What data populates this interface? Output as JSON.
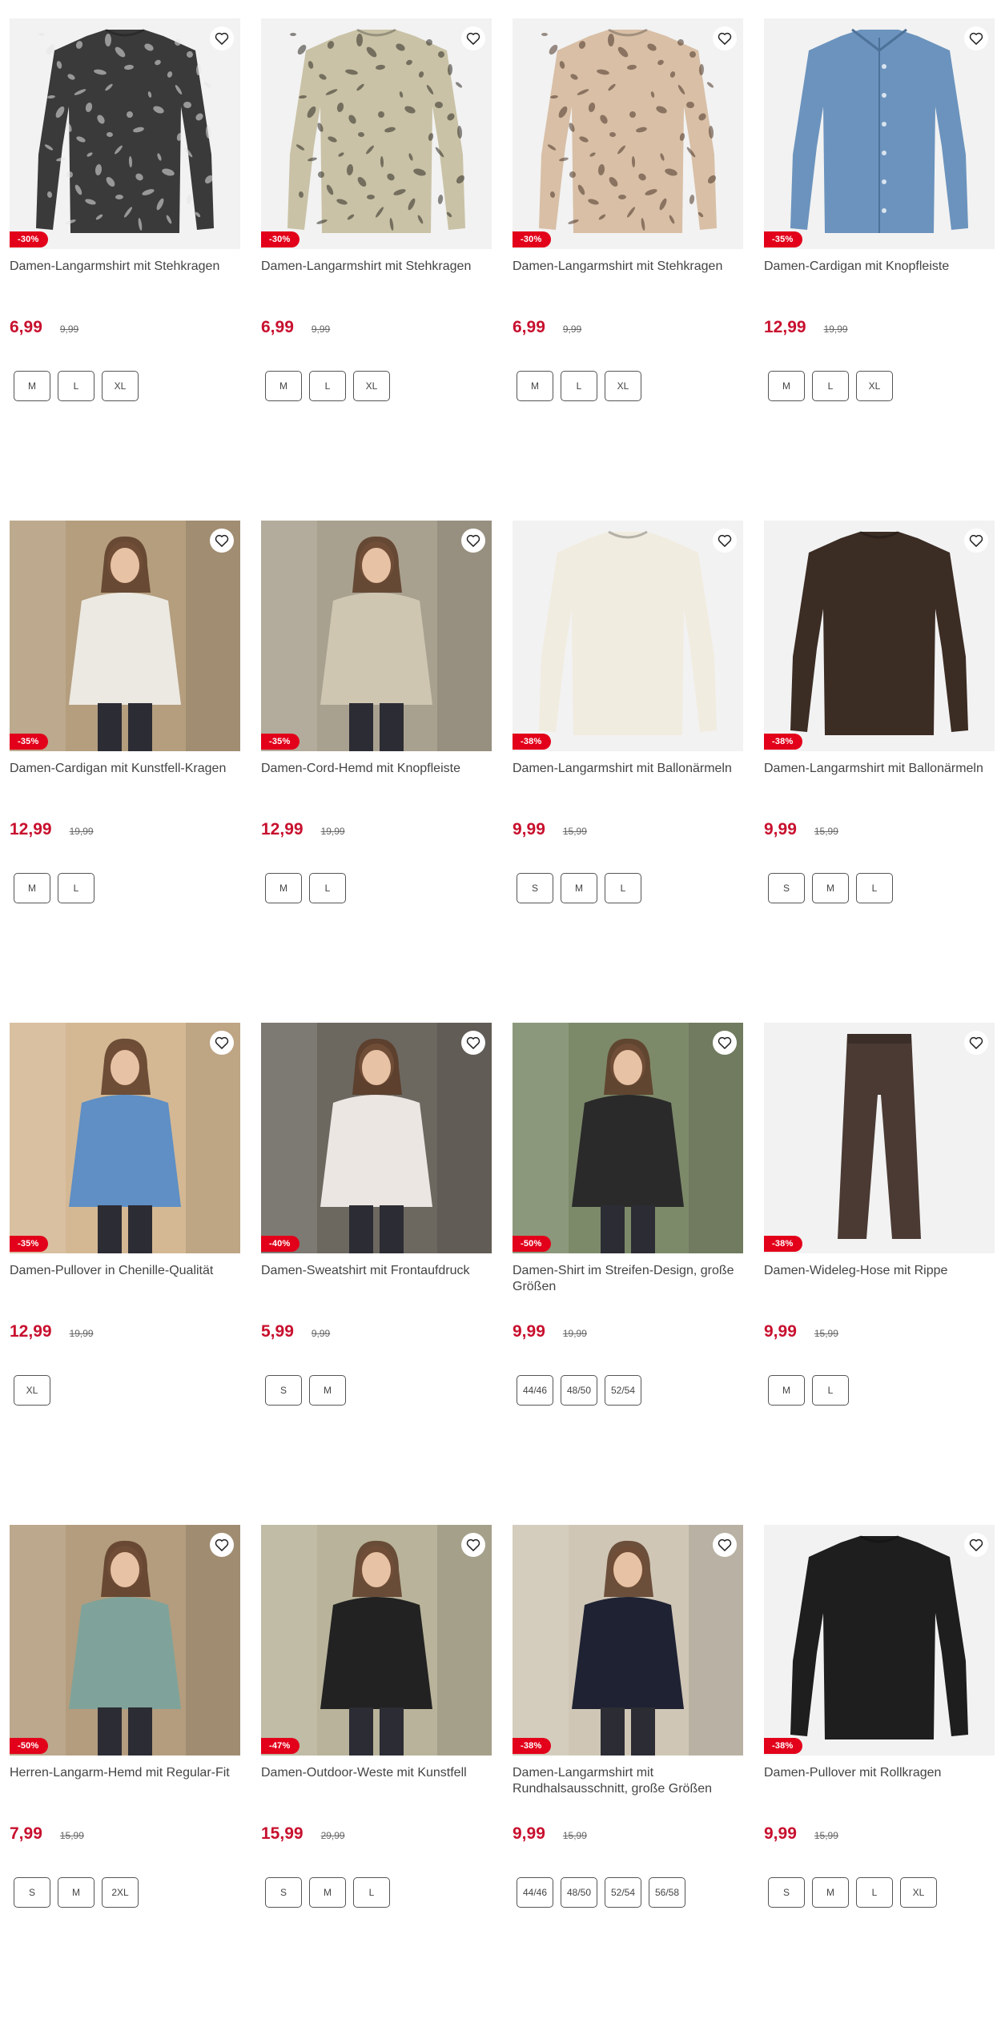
{
  "products": [
    {
      "title": "Damen-Langarmshirt mit Stehkragen",
      "price": "6,99",
      "old_price": "9,99",
      "discount": "-30%",
      "sizes": [
        "M",
        "L",
        "XL"
      ],
      "image": "garment",
      "color": "#3a3a3a",
      "pattern": "#e6e6e6",
      "garment": "shirt"
    },
    {
      "title": "Damen-Langarmshirt mit Stehkragen",
      "price": "6,99",
      "old_price": "9,99",
      "discount": "-30%",
      "sizes": [
        "M",
        "L",
        "XL"
      ],
      "image": "garment",
      "color": "#c9c2a6",
      "pattern": "#2e2a22",
      "garment": "shirt"
    },
    {
      "title": "Damen-Langarmshirt mit Stehkragen",
      "price": "6,99",
      "old_price": "9,99",
      "discount": "-30%",
      "sizes": [
        "M",
        "L",
        "XL"
      ],
      "image": "garment",
      "color": "#d8bfa6",
      "pattern": "#4a3426",
      "garment": "shirt"
    },
    {
      "title": "Damen-Cardigan mit Knopfleiste",
      "price": "12,99",
      "old_price": "19,99",
      "discount": "-35%",
      "sizes": [
        "M",
        "L",
        "XL"
      ],
      "image": "garment",
      "color": "#6b93bd",
      "pattern": "",
      "garment": "cardigan"
    },
    {
      "title": "Damen-Cardigan mit Kunstfell-Kragen",
      "price": "12,99",
      "old_price": "19,99",
      "discount": "-35%",
      "sizes": [
        "M",
        "L"
      ],
      "image": "photo",
      "color": "#ece9e2",
      "bg": "#b49e7e",
      "garment": "model"
    },
    {
      "title": "Damen-Cord-Hemd mit Knopfleiste",
      "price": "12,99",
      "old_price": "19,99",
      "discount": "-35%",
      "sizes": [
        "M",
        "L"
      ],
      "image": "photo",
      "color": "#cfc6b2",
      "bg": "#a9a18f",
      "garment": "model"
    },
    {
      "title": "Damen-Langarmshirt mit Ballonärmeln",
      "price": "9,99",
      "old_price": "15,99",
      "discount": "-38%",
      "sizes": [
        "S",
        "M",
        "L"
      ],
      "image": "garment",
      "color": "#f1ece0",
      "pattern": "",
      "garment": "sweater"
    },
    {
      "title": "Damen-Langarmshirt mit Ballonärmeln",
      "price": "9,99",
      "old_price": "15,99",
      "discount": "-38%",
      "sizes": [
        "S",
        "M",
        "L"
      ],
      "image": "garment",
      "color": "#3b2c24",
      "pattern": "",
      "garment": "sweater"
    },
    {
      "title": "Damen-Pullover in Chenille-Qualität",
      "price": "12,99",
      "old_price": "19,99",
      "discount": "-35%",
      "sizes": [
        "XL"
      ],
      "image": "photo",
      "color": "#5f8fc4",
      "bg": "#d4b894",
      "garment": "model"
    },
    {
      "title": "Damen-Sweatshirt mit Frontaufdruck",
      "price": "5,99",
      "old_price": "9,99",
      "discount": "-40%",
      "sizes": [
        "S",
        "M"
      ],
      "image": "photo",
      "color": "#ece6e2",
      "bg": "#6c6860",
      "garment": "model"
    },
    {
      "title": "Damen-Shirt im Streifen-Design, große Größen",
      "price": "9,99",
      "old_price": "19,99",
      "discount": "-50%",
      "sizes": [
        "44/46",
        "48/50",
        "52/54"
      ],
      "image": "photo",
      "color": "#2a2a2a",
      "bg": "#7d8a6a",
      "garment": "model"
    },
    {
      "title": "Damen-Wideleg-Hose mit Rippe",
      "price": "9,99",
      "old_price": "15,99",
      "discount": "-38%",
      "sizes": [
        "M",
        "L"
      ],
      "image": "garment",
      "color": "#4a3a33",
      "pattern": "",
      "garment": "pants"
    },
    {
      "title": "Herren-Langarm-Hemd mit Regular-Fit",
      "price": "7,99",
      "old_price": "15,99",
      "discount": "-50%",
      "sizes": [
        "S",
        "M",
        "2XL"
      ],
      "image": "photo",
      "color": "#7fa39a",
      "bg": "#b39d7e",
      "garment": "model"
    },
    {
      "title": "Damen-Outdoor-Weste mit Kunstfell",
      "price": "15,99",
      "old_price": "29,99",
      "discount": "-47%",
      "sizes": [
        "S",
        "M",
        "L"
      ],
      "image": "photo",
      "color": "#222222",
      "bg": "#b8b39a",
      "garment": "model"
    },
    {
      "title": "Damen-Langarmshirt mit Rundhalsausschnitt, große Größen",
      "price": "9,99",
      "old_price": "15,99",
      "discount": "-38%",
      "sizes": [
        "44/46",
        "48/50",
        "52/54",
        "56/58"
      ],
      "image": "photo",
      "color": "#1f2233",
      "bg": "#cfc6b6",
      "garment": "model"
    },
    {
      "title": "Damen-Pullover mit Rollkragen",
      "price": "9,99",
      "old_price": "15,99",
      "discount": "-38%",
      "sizes": [
        "S",
        "M",
        "L",
        "XL"
      ],
      "image": "garment",
      "color": "#1e1e1e",
      "pattern": "",
      "garment": "sweater"
    }
  ]
}
